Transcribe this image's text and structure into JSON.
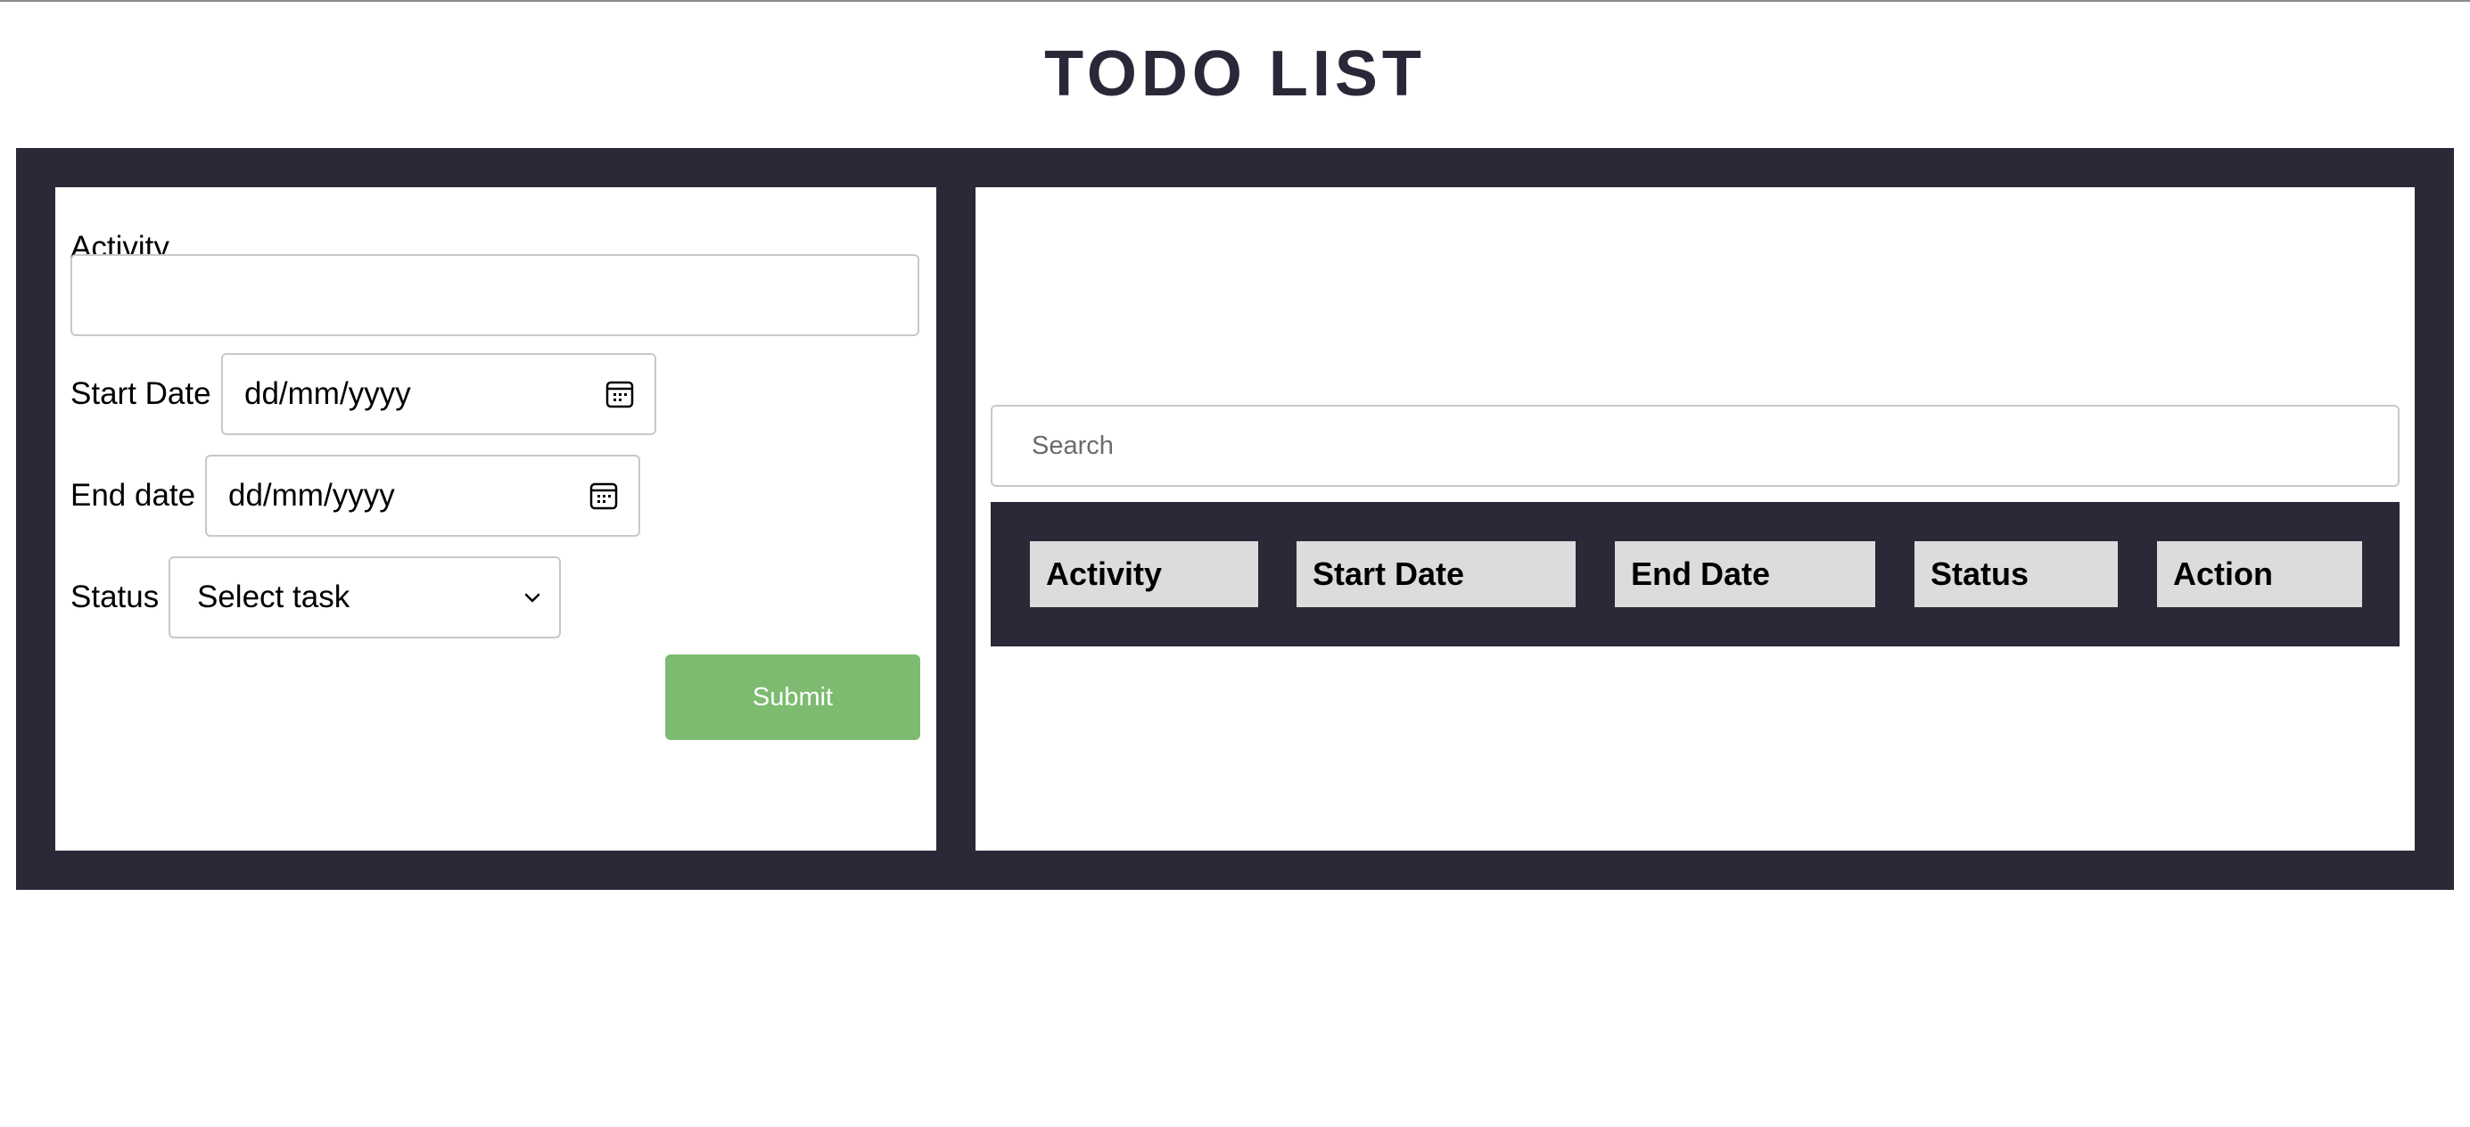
{
  "page": {
    "title": "TODO LIST",
    "colors": {
      "frame": "#2b2838",
      "submit": "#7dbb70",
      "header_cell": "#dcdcdc"
    }
  },
  "form": {
    "activity_label": "Activity",
    "activity_value": "",
    "start_date_label": "Start Date",
    "start_date_placeholder": "dd/mm/yyyy",
    "end_date_label": "End date",
    "end_date_placeholder": "dd/mm/yyyy",
    "status_label": "Status",
    "status_selected": "Select task",
    "submit_label": "Submit",
    "icons": [
      "calendar-icon",
      "chevron-down-icon"
    ]
  },
  "list": {
    "search_placeholder": "Search",
    "columns": [
      "Activity",
      "Start Date",
      "End Date",
      "Status",
      "Action"
    ],
    "rows": []
  }
}
